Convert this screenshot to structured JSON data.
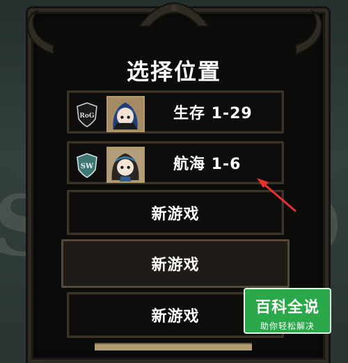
{
  "title": "选择位置",
  "slots": [
    {
      "type": "save",
      "badge": "RoG",
      "text": "生存  1-29"
    },
    {
      "type": "save",
      "badge": "SW",
      "text": "航海  1-6"
    },
    {
      "type": "new",
      "text": "新游戏"
    },
    {
      "type": "new",
      "text": "新游戏",
      "selected": true
    },
    {
      "type": "new",
      "text": "新游戏"
    }
  ],
  "watermark": {
    "brand": "百科全说",
    "tagline": "助你轻松解决"
  },
  "colors": {
    "arrow": "#e5322f",
    "watermark_bg": "#2aa84a"
  }
}
